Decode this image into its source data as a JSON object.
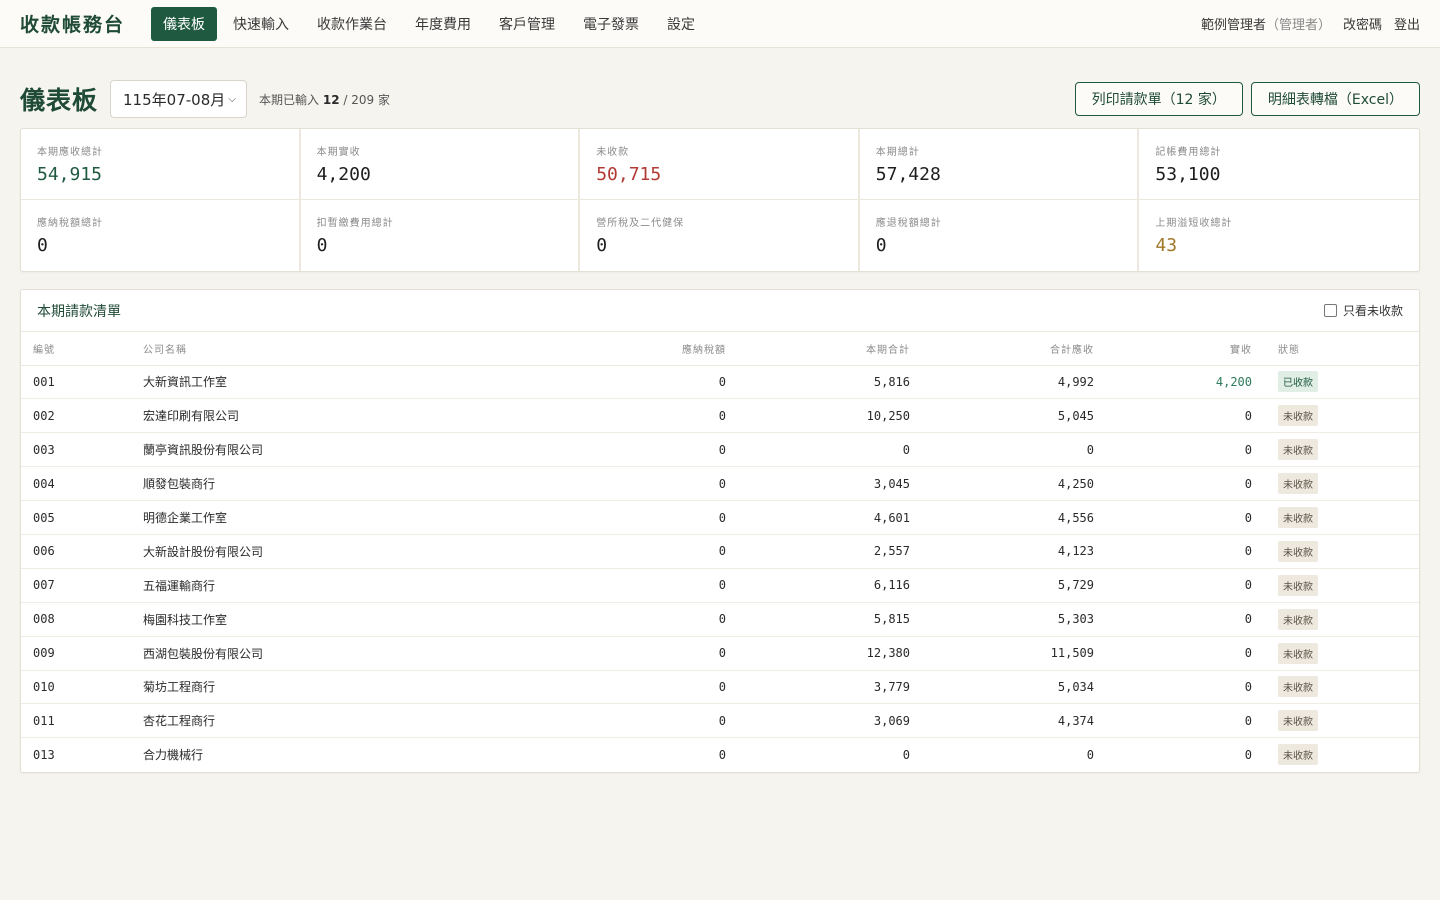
{
  "app": {
    "brand": "收款帳務台",
    "nav": [
      "儀表板",
      "快速輸入",
      "收款作業台",
      "年度費用",
      "客戶管理",
      "電子發票",
      "設定"
    ],
    "active_nav": 0,
    "user": "範例管理者",
    "role": "（管理者）",
    "change_password": "改密碼",
    "logout": "登出"
  },
  "header": {
    "title": "儀表板",
    "period": "115年07-08月",
    "entered_prefix": "本期已輸入",
    "entered_count": "12",
    "entered_total": " / 209 家",
    "print_button": "列印請款單（12 家）",
    "export_button": "明細表轉檔（Excel）"
  },
  "stats": [
    {
      "label": "本期應收總計",
      "value": "54,915",
      "color": "green"
    },
    {
      "label": "本期實收",
      "value": "4,200",
      "color": ""
    },
    {
      "label": "未收款",
      "value": "50,715",
      "color": "red"
    },
    {
      "label": "本期總計",
      "value": "57,428",
      "color": ""
    },
    {
      "label": "記帳費用總計",
      "value": "53,100",
      "color": ""
    },
    {
      "label": "應納稅額總計",
      "value": "0",
      "color": ""
    },
    {
      "label": "扣暫繳費用總計",
      "value": "0",
      "color": ""
    },
    {
      "label": "營所稅及二代健保",
      "value": "0",
      "color": ""
    },
    {
      "label": "應退稅額總計",
      "value": "0",
      "color": ""
    },
    {
      "label": "上期溢短收總計",
      "value": "43",
      "color": "gold"
    }
  ],
  "table": {
    "title": "本期請款清單",
    "filter_label": "只看未收款",
    "columns": [
      "編號",
      "公司名稱",
      "應納稅額",
      "本期合計",
      "合計應收",
      "實收",
      "狀態"
    ],
    "rows": [
      {
        "id": "001",
        "name": "大新資訊工作室",
        "tax": "0",
        "total": "5,816",
        "receivable": "4,992",
        "paid": "4,200",
        "status": "已收款",
        "is_paid": true
      },
      {
        "id": "002",
        "name": "宏達印刷有限公司",
        "tax": "0",
        "total": "10,250",
        "receivable": "5,045",
        "paid": "0",
        "status": "未收款",
        "is_paid": false
      },
      {
        "id": "003",
        "name": "蘭亭資訊股份有限公司",
        "tax": "0",
        "total": "0",
        "receivable": "0",
        "paid": "0",
        "status": "未收款",
        "is_paid": false
      },
      {
        "id": "004",
        "name": "順發包裝商行",
        "tax": "0",
        "total": "3,045",
        "receivable": "4,250",
        "paid": "0",
        "status": "未收款",
        "is_paid": false
      },
      {
        "id": "005",
        "name": "明德企業工作室",
        "tax": "0",
        "total": "4,601",
        "receivable": "4,556",
        "paid": "0",
        "status": "未收款",
        "is_paid": false
      },
      {
        "id": "006",
        "name": "大新設計股份有限公司",
        "tax": "0",
        "total": "2,557",
        "receivable": "4,123",
        "paid": "0",
        "status": "未收款",
        "is_paid": false
      },
      {
        "id": "007",
        "name": "五福運輸商行",
        "tax": "0",
        "total": "6,116",
        "receivable": "5,729",
        "paid": "0",
        "status": "未收款",
        "is_paid": false
      },
      {
        "id": "008",
        "name": "梅園科技工作室",
        "tax": "0",
        "total": "5,815",
        "receivable": "5,303",
        "paid": "0",
        "status": "未收款",
        "is_paid": false
      },
      {
        "id": "009",
        "name": "西湖包裝股份有限公司",
        "tax": "0",
        "total": "12,380",
        "receivable": "11,509",
        "paid": "0",
        "status": "未收款",
        "is_paid": false
      },
      {
        "id": "010",
        "name": "菊坊工程商行",
        "tax": "0",
        "total": "3,779",
        "receivable": "5,034",
        "paid": "0",
        "status": "未收款",
        "is_paid": false
      },
      {
        "id": "011",
        "name": "杏花工程商行",
        "tax": "0",
        "total": "3,069",
        "receivable": "4,374",
        "paid": "0",
        "status": "未收款",
        "is_paid": false
      },
      {
        "id": "013",
        "name": "合力機械行",
        "tax": "0",
        "total": "0",
        "receivable": "0",
        "paid": "0",
        "status": "未收款",
        "is_paid": false
      }
    ]
  }
}
